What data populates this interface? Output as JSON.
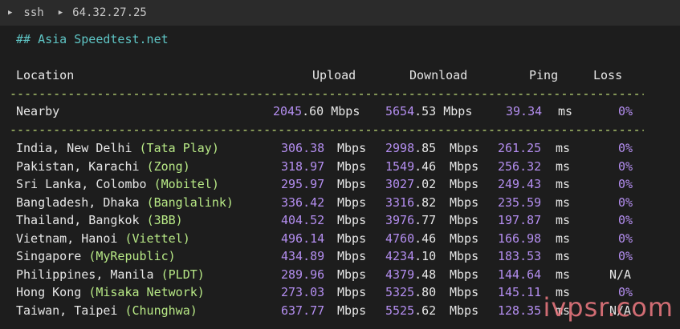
{
  "titlebar": {
    "shell": "ssh",
    "host": "64.32.27.25"
  },
  "heading": "## Asia Speedtest.net",
  "columns": {
    "location": "Location",
    "upload": "Upload",
    "download": "Download",
    "ping": "Ping",
    "loss": "Loss"
  },
  "dashes": "----------------------------------------------------------------------------------------",
  "nearby": {
    "location": "Nearby",
    "up_int": "2045",
    "up_dec": ".60",
    "up_unit": " Mbps",
    "dl_int": "5654",
    "dl_dec": ".53",
    "dl_unit": " Mbps",
    "ping": "39.34",
    "ping_unit": " ms",
    "loss": "0%"
  },
  "rows": [
    {
      "city": "India, New Delhi ",
      "isp": "(Tata Play)",
      "up": "306.38",
      "dl_int": "2998",
      "dl_dec": ".85",
      "ping": "261.25",
      "loss": "0%"
    },
    {
      "city": "Pakistan, Karachi ",
      "isp": "(Zong)",
      "up": "318.97",
      "dl_int": "1549",
      "dl_dec": ".46",
      "ping": "256.32",
      "loss": "0%"
    },
    {
      "city": "Sri Lanka, Colombo ",
      "isp": "(Mobitel)",
      "up": "295.97",
      "dl_int": "3027",
      "dl_dec": ".02",
      "ping": "249.43",
      "loss": "0%"
    },
    {
      "city": "Bangladesh, Dhaka ",
      "isp": "(Banglalink)",
      "up": "336.42",
      "dl_int": "3316",
      "dl_dec": ".82",
      "ping": "235.59",
      "loss": "0%"
    },
    {
      "city": "Thailand, Bangkok ",
      "isp": "(3BB)",
      "up": "404.52",
      "dl_int": "3976",
      "dl_dec": ".77",
      "ping": "197.87",
      "loss": "0%"
    },
    {
      "city": "Vietnam, Hanoi ",
      "isp": "(Viettel)",
      "up": "496.14",
      "dl_int": "4760",
      "dl_dec": ".46",
      "ping": "166.98",
      "loss": "0%"
    },
    {
      "city": "Singapore ",
      "isp": "(MyRepublic)",
      "up": "434.89",
      "dl_int": "4234",
      "dl_dec": ".10",
      "ping": "183.53",
      "loss": "0%"
    },
    {
      "city": "Philippines, Manila ",
      "isp": "(PLDT)",
      "up": "289.96",
      "dl_int": "4379",
      "dl_dec": ".48",
      "ping": "144.64",
      "loss": "N/A"
    },
    {
      "city": "Hong Kong ",
      "isp": "(Misaka Network)",
      "up": "273.03",
      "dl_int": "5325",
      "dl_dec": ".80",
      "ping": "145.11",
      "loss": "0%"
    },
    {
      "city": "Taiwan, Taipei ",
      "isp": "(Chunghwa)",
      "up": "637.77",
      "dl_int": "5525",
      "dl_dec": ".62",
      "ping": "128.35",
      "loss": "N/A"
    }
  ],
  "units": {
    "mbps": "Mbps",
    "ms": "ms"
  },
  "watermark": "ivpsr.com",
  "colors": {
    "accent": "#b48ef0",
    "heading": "#5ec4c4",
    "isp": "#b8e986"
  }
}
